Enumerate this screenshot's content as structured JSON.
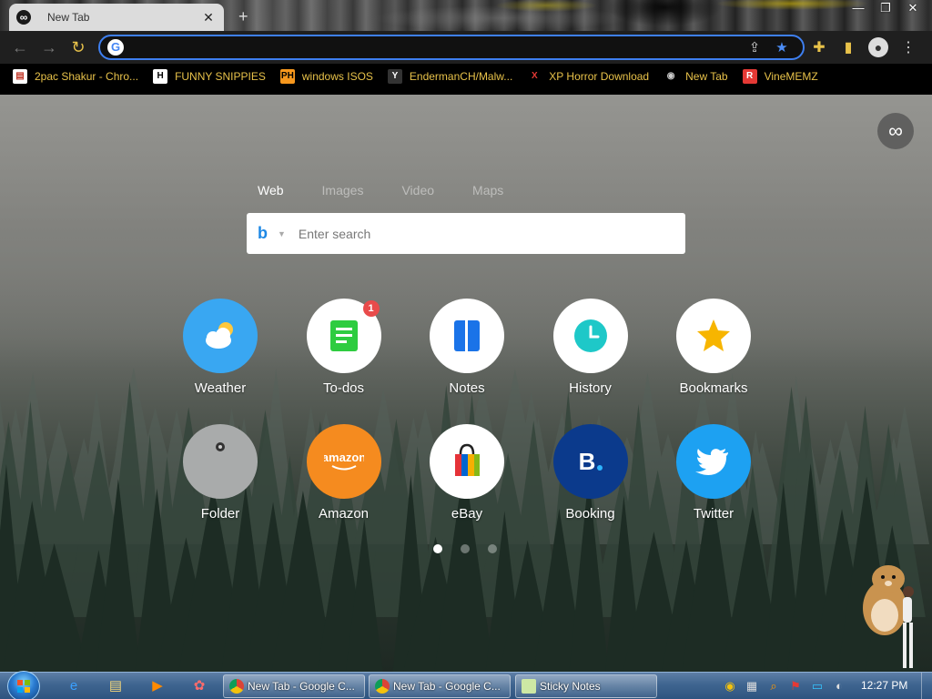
{
  "browser": {
    "tab": {
      "title": "New Tab",
      "favicon": "infinity-icon",
      "close": "✕"
    },
    "new_tab": "+",
    "window_controls": {
      "minimize": "—",
      "maximize": "❐",
      "close": "✕"
    },
    "toolbar": {
      "back": "←",
      "forward": "→",
      "reload": "↻",
      "address_value": "",
      "google_icon": "G",
      "share_icon": "⇪",
      "star_icon": "★",
      "extensions_icon": "✚",
      "sidepanel_icon": "▮",
      "profile_icon": "●",
      "menu_icon": "⋮"
    },
    "bookmarks": [
      {
        "label": "2pac Shakur - Chro...",
        "icon": "▤",
        "icon_bg": "#ffffff",
        "icon_color": "#c0392b"
      },
      {
        "label": "FUNNY SNIPPIES",
        "icon": "H",
        "icon_bg": "#ffffff",
        "icon_color": "#000000"
      },
      {
        "label": "windows ISOS",
        "icon": "PH",
        "icon_bg": "#f7971d",
        "icon_color": "#000000"
      },
      {
        "label": "EndermanCH/Malw...",
        "icon": "Y",
        "icon_bg": "#333333",
        "icon_color": "#ffffff"
      },
      {
        "label": "XP Horror Download",
        "icon": "X",
        "icon_bg": "#000000",
        "icon_color": "#e53935"
      },
      {
        "label": "New Tab",
        "icon": "◉",
        "icon_bg": "#000000",
        "icon_color": "#cccccc"
      },
      {
        "label": "VineMEMZ",
        "icon": "R",
        "icon_bg": "#e53935",
        "icon_color": "#ffffff"
      }
    ]
  },
  "newtab": {
    "infinity_icon": "∞",
    "search_tabs": [
      {
        "label": "Web",
        "active": true
      },
      {
        "label": "Images",
        "active": false
      },
      {
        "label": "Video",
        "active": false
      },
      {
        "label": "Maps",
        "active": false
      }
    ],
    "search": {
      "engine_icon": "b",
      "caret": "▼",
      "placeholder": "Enter search",
      "value": ""
    },
    "tiles": [
      {
        "label": "Weather",
        "icon": "weather-icon",
        "bg": "#39a7f2"
      },
      {
        "label": "To-dos",
        "icon": "todos-icon",
        "bg": "#ffffff",
        "badge": "1"
      },
      {
        "label": "Notes",
        "icon": "notes-icon",
        "bg": "#ffffff"
      },
      {
        "label": "History",
        "icon": "history-icon",
        "bg": "#ffffff"
      },
      {
        "label": "Bookmarks",
        "icon": "bookmarks-icon",
        "bg": "#ffffff"
      },
      {
        "label": "Folder",
        "icon": "folder-icon",
        "bg": "#a9abab"
      },
      {
        "label": "Amazon",
        "icon": "amazon-icon",
        "bg": "#f58b1f",
        "text": "amazon"
      },
      {
        "label": "eBay",
        "icon": "ebay-icon",
        "bg": "#ffffff"
      },
      {
        "label": "Booking",
        "icon": "booking-icon",
        "bg": "#0b3a8c",
        "text": "B."
      },
      {
        "label": "Twitter",
        "icon": "twitter-icon",
        "bg": "#1da1f2"
      }
    ],
    "pagination": {
      "pages": 3,
      "active": 1
    }
  },
  "taskbar": {
    "pinned": [
      {
        "icon": "ie-icon",
        "glyph": "e",
        "color": "#3aa0ff"
      },
      {
        "icon": "explorer-icon",
        "glyph": "▤",
        "color": "#f5d77a"
      },
      {
        "icon": "media-player-icon",
        "glyph": "▶",
        "color": "#ff8a00"
      },
      {
        "icon": "paint-icon",
        "glyph": "✿",
        "color": "#ff6b6b"
      }
    ],
    "tasks": [
      {
        "label": "New Tab - Google C...",
        "icon": "chrome"
      },
      {
        "label": "New Tab - Google C...",
        "icon": "chrome"
      },
      {
        "label": "Sticky Notes",
        "icon": "sticky"
      }
    ],
    "tray": [
      {
        "icon": "chrome-tray-icon",
        "glyph": "◉",
        "color": "#f4c20d"
      },
      {
        "icon": "network-tray-icon",
        "glyph": "▦",
        "color": "#dddddd"
      },
      {
        "icon": "search-tray-icon",
        "glyph": "⌕",
        "color": "#ff9900"
      },
      {
        "icon": "flag-tray-icon",
        "glyph": "⚑",
        "color": "#e53935"
      },
      {
        "icon": "monitor-tray-icon",
        "glyph": "▭",
        "color": "#35c5ff"
      },
      {
        "icon": "volume-tray-icon",
        "glyph": "◐",
        "color": "#e0e0e0"
      }
    ],
    "clock": "12:27 PM"
  }
}
